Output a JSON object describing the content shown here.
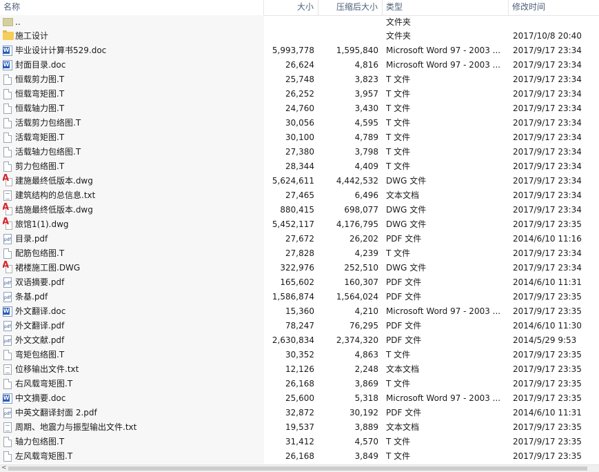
{
  "columns": {
    "name": "名称",
    "size": "大小",
    "compressed": "压缩后大小",
    "type": "类型",
    "modified": "修改时间"
  },
  "files": [
    {
      "icon": "folder-up-icon",
      "name": "..",
      "size": "",
      "compressed": "",
      "type": "文件夹",
      "modified": ""
    },
    {
      "icon": "folder-icon",
      "name": "施工设计",
      "size": "",
      "compressed": "",
      "type": "文件夹",
      "modified": "2017/10/8 20:40"
    },
    {
      "icon": "word-doc-icon",
      "name": "毕业设计计算书529.doc",
      "size": "5,993,778",
      "compressed": "1,595,840",
      "type": "Microsoft Word 97 - 2003 ...",
      "modified": "2017/9/17 23:34"
    },
    {
      "icon": "word-doc-icon",
      "name": "封面目录.doc",
      "size": "26,624",
      "compressed": "4,816",
      "type": "Microsoft Word 97 - 2003 ...",
      "modified": "2017/9/17 23:34"
    },
    {
      "icon": "file-icon",
      "name": "恒载剪力图.T",
      "size": "25,748",
      "compressed": "3,823",
      "type": "T 文件",
      "modified": "2017/9/17 23:34"
    },
    {
      "icon": "file-icon",
      "name": "恒载弯矩图.T",
      "size": "26,252",
      "compressed": "3,957",
      "type": "T 文件",
      "modified": "2017/9/17 23:34"
    },
    {
      "icon": "file-icon",
      "name": "恒载轴力图.T",
      "size": "24,760",
      "compressed": "3,430",
      "type": "T 文件",
      "modified": "2017/9/17 23:34"
    },
    {
      "icon": "file-icon",
      "name": "活载剪力包络图.T",
      "size": "30,056",
      "compressed": "4,595",
      "type": "T 文件",
      "modified": "2017/9/17 23:34"
    },
    {
      "icon": "file-icon",
      "name": "活载弯矩图.T",
      "size": "30,100",
      "compressed": "4,789",
      "type": "T 文件",
      "modified": "2017/9/17 23:34"
    },
    {
      "icon": "file-icon",
      "name": "活载轴力包络图.T",
      "size": "27,380",
      "compressed": "3,798",
      "type": "T 文件",
      "modified": "2017/9/17 23:34"
    },
    {
      "icon": "file-icon",
      "name": "剪力包络图.T",
      "size": "28,344",
      "compressed": "4,409",
      "type": "T 文件",
      "modified": "2017/9/17 23:34"
    },
    {
      "icon": "dwg-icon",
      "name": "建施最终低版本.dwg",
      "size": "5,624,611",
      "compressed": "4,442,532",
      "type": "DWG 文件",
      "modified": "2017/9/17 23:34"
    },
    {
      "icon": "text-file-icon",
      "name": "建筑结构的总信息.txt",
      "size": "27,465",
      "compressed": "6,496",
      "type": "文本文档",
      "modified": "2017/9/17 23:34"
    },
    {
      "icon": "dwg-icon",
      "name": "结施最终低版本.dwg",
      "size": "880,415",
      "compressed": "698,077",
      "type": "DWG 文件",
      "modified": "2017/9/17 23:34"
    },
    {
      "icon": "dwg-icon",
      "name": "旅馆1(1).dwg",
      "size": "5,452,117",
      "compressed": "4,176,795",
      "type": "DWG 文件",
      "modified": "2017/9/17 23:35"
    },
    {
      "icon": "pdf-icon",
      "name": "目录.pdf",
      "size": "27,672",
      "compressed": "26,202",
      "type": "PDF 文件",
      "modified": "2014/6/10 11:16"
    },
    {
      "icon": "file-icon",
      "name": "配筋包络图.T",
      "size": "27,828",
      "compressed": "4,239",
      "type": "T 文件",
      "modified": "2017/9/17 23:34"
    },
    {
      "icon": "dwg-icon",
      "name": "裙楼施工图.DWG",
      "size": "322,976",
      "compressed": "252,510",
      "type": "DWG 文件",
      "modified": "2017/9/17 23:34"
    },
    {
      "icon": "pdf-icon",
      "name": "双语摘要.pdf",
      "size": "165,602",
      "compressed": "160,307",
      "type": "PDF 文件",
      "modified": "2014/6/10 11:31"
    },
    {
      "icon": "pdf-icon",
      "name": "条基.pdf",
      "size": "1,586,874",
      "compressed": "1,564,024",
      "type": "PDF 文件",
      "modified": "2017/9/17 23:35"
    },
    {
      "icon": "word-doc-icon",
      "name": "外文翻译.doc",
      "size": "15,360",
      "compressed": "4,210",
      "type": "Microsoft Word 97 - 2003 ...",
      "modified": "2017/9/17 23:35"
    },
    {
      "icon": "pdf-icon",
      "name": "外文翻译.pdf",
      "size": "78,247",
      "compressed": "76,295",
      "type": "PDF 文件",
      "modified": "2014/6/10 11:30"
    },
    {
      "icon": "pdf-icon",
      "name": "外文文献.pdf",
      "size": "2,630,834",
      "compressed": "2,374,320",
      "type": "PDF 文件",
      "modified": "2014/5/29 9:53"
    },
    {
      "icon": "file-icon",
      "name": "弯矩包络图.T",
      "size": "30,352",
      "compressed": "4,863",
      "type": "T 文件",
      "modified": "2017/9/17 23:35"
    },
    {
      "icon": "text-file-icon",
      "name": "位移输出文件.txt",
      "size": "12,126",
      "compressed": "2,248",
      "type": "文本文档",
      "modified": "2017/9/17 23:35"
    },
    {
      "icon": "file-icon",
      "name": "右风载弯矩图.T",
      "size": "26,168",
      "compressed": "3,869",
      "type": "T 文件",
      "modified": "2017/9/17 23:35"
    },
    {
      "icon": "word-doc-icon",
      "name": "中文摘要.doc",
      "size": "25,600",
      "compressed": "5,318",
      "type": "Microsoft Word 97 - 2003 ...",
      "modified": "2017/9/17 23:35"
    },
    {
      "icon": "pdf-icon",
      "name": "中英文翻译封面 2.pdf",
      "size": "32,872",
      "compressed": "30,192",
      "type": "PDF 文件",
      "modified": "2014/6/10 11:31"
    },
    {
      "icon": "text-file-icon",
      "name": "周期、地震力与振型输出文件.txt",
      "size": "19,537",
      "compressed": "3,889",
      "type": "文本文档",
      "modified": "2017/9/17 23:35"
    },
    {
      "icon": "file-icon",
      "name": "轴力包络图.T",
      "size": "31,412",
      "compressed": "4,570",
      "type": "T 文件",
      "modified": "2017/9/17 23:35"
    },
    {
      "icon": "file-icon",
      "name": "左风载弯矩图.T",
      "size": "26,168",
      "compressed": "3,849",
      "type": "T 文件",
      "modified": "2017/9/17 23:35"
    }
  ],
  "scrollbar": {
    "left_arrow": "<"
  }
}
